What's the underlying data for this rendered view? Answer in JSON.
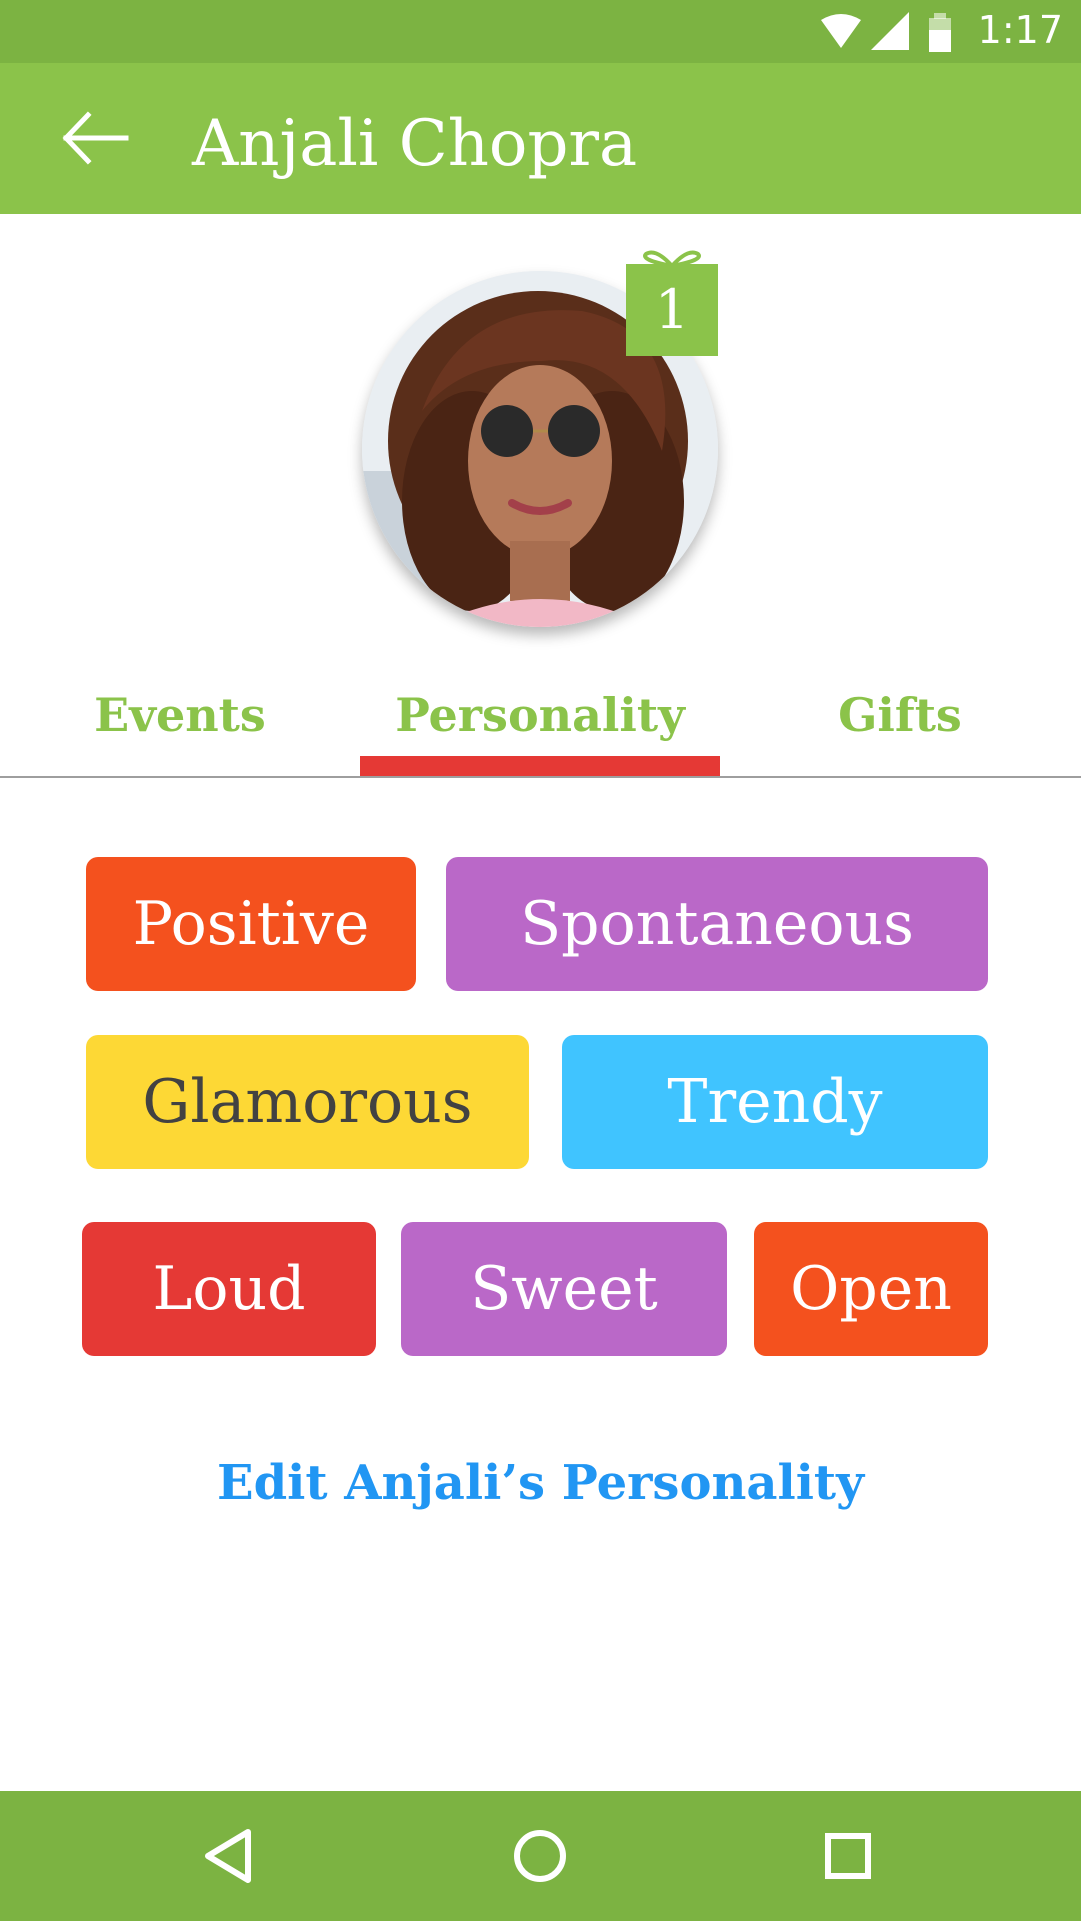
{
  "status_bar": {
    "time": "1:17",
    "icons": [
      "wifi-icon",
      "cell-signal-icon",
      "battery-icon"
    ]
  },
  "app_bar": {
    "back_icon": "arrow-left-icon",
    "title": "Anjali Chopra"
  },
  "profile": {
    "gift_count": "1"
  },
  "tabs": [
    {
      "label": "Events",
      "selected": false
    },
    {
      "label": "Personality",
      "selected": true
    },
    {
      "label": "Gifts",
      "selected": false
    }
  ],
  "personality_tags": [
    {
      "label": "Positive",
      "color": "#f4511e"
    },
    {
      "label": "Spontaneous",
      "color": "#ba68c8"
    },
    {
      "label": "Glamorous",
      "color": "#fdd835"
    },
    {
      "label": "Trendy",
      "color": "#40c4ff"
    },
    {
      "label": "Loud",
      "color": "#e53935"
    },
    {
      "label": "Sweet",
      "color": "#ba68c8"
    },
    {
      "label": "Open",
      "color": "#f4511e"
    }
  ],
  "edit_link": "Edit Anjali’s Personality",
  "nav_bar": {
    "icons": [
      "back-triangle-icon",
      "home-circle-icon",
      "recents-square-icon"
    ]
  },
  "colors": {
    "primary": "#8bc34a",
    "primary_dark": "#7cb342",
    "tab_indicator": "#e53935",
    "link": "#2196f3"
  }
}
